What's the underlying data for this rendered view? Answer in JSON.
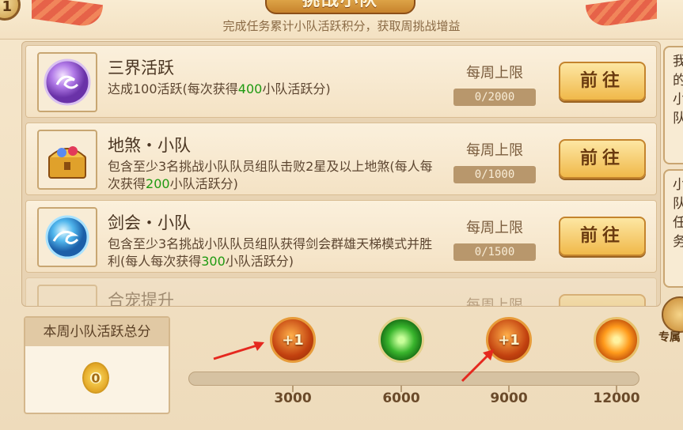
{
  "header": {
    "badge": "1",
    "title": "挑战小队",
    "subtitle": "完成任务累计小队活跃积分，获取周挑战增益"
  },
  "tasks": [
    {
      "name": "三界活跃",
      "desc_parts": [
        "达成100活跃(每次获得",
        "400",
        "小队活跃分)"
      ],
      "limit_label": "每周上限",
      "limit_value": "0/2000",
      "button": "前往",
      "icon": "purple-swirl-orb-icon"
    },
    {
      "name": "地煞・小队",
      "desc_parts": [
        "包含至少3名挑战小队队员组队击败2星及以上地煞(每人每次获得",
        "200",
        "小队活跃分)"
      ],
      "limit_label": "每周上限",
      "limit_value": "0/1000",
      "button": "前往",
      "icon": "treasure-chest-icon"
    },
    {
      "name": "剑会・小队",
      "desc_parts": [
        "包含至少3名挑战小队队员组队获得剑会群雄天梯模式并胜利(每人每次获得",
        "300",
        "小队活跃分)"
      ],
      "limit_label": "每周上限",
      "limit_value": "0/1500",
      "button": "前往",
      "icon": "blue-swirl-orb-icon"
    },
    {
      "name": "合宠提升",
      "limit_label": "每周上限"
    }
  ],
  "side": {
    "card1": [
      "我",
      "的",
      "小",
      "队"
    ],
    "card2": [
      "小",
      "队",
      "任",
      "务"
    ],
    "coin_label": "专属"
  },
  "score": {
    "title": "本周小队活跃总分",
    "value": "0"
  },
  "milestones": [
    {
      "label": "3000",
      "reward": "+1",
      "type": "plus"
    },
    {
      "label": "6000",
      "reward": "",
      "type": "green"
    },
    {
      "label": "9000",
      "reward": "+1",
      "type": "plus"
    },
    {
      "label": "12000",
      "reward": "",
      "type": "orange"
    }
  ],
  "progress": 0,
  "colors": {
    "highlight": "#1f9a12",
    "button": "#f0b94a",
    "annotation_arrow": "#e5281f"
  }
}
